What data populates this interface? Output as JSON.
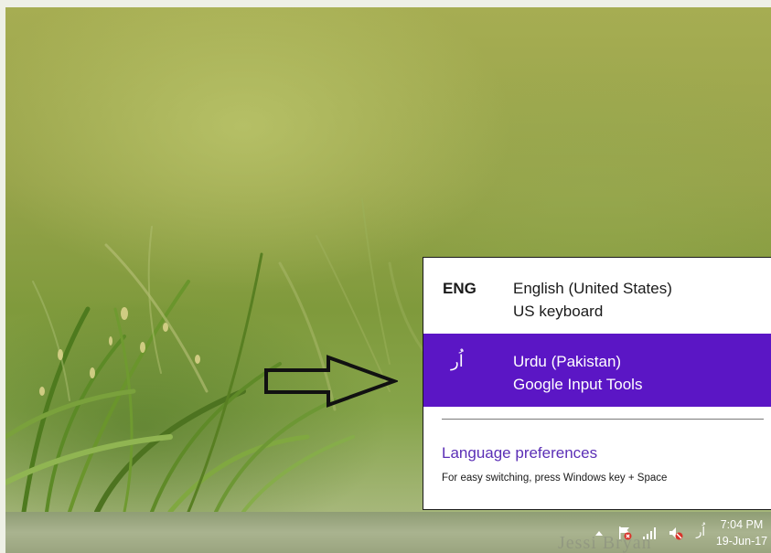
{
  "language_flyout": {
    "items": [
      {
        "code": "ENG",
        "language": "English (United States)",
        "keyboard": "US keyboard",
        "selected": false
      },
      {
        "code": "اُر",
        "language": "Urdu (Pakistan)",
        "keyboard": "Google Input Tools",
        "selected": true
      }
    ],
    "preferences_link": "Language preferences",
    "switch_hint": "For easy switching, press Windows key + Space"
  },
  "taskbar": {
    "tray_icons": [
      "show-hidden-icons-arrow",
      "action-center-flag-icon",
      "network-signal-icon",
      "volume-muted-icon"
    ],
    "ime_indicator": "اُر",
    "clock": {
      "time": "7:04 PM",
      "date": "19-Jun-17"
    }
  },
  "watermark": "Jessi Bryan",
  "colors": {
    "selected_item": "#5b16c5",
    "link": "#5b2fb6",
    "flyout_bg": "#ffffff"
  }
}
